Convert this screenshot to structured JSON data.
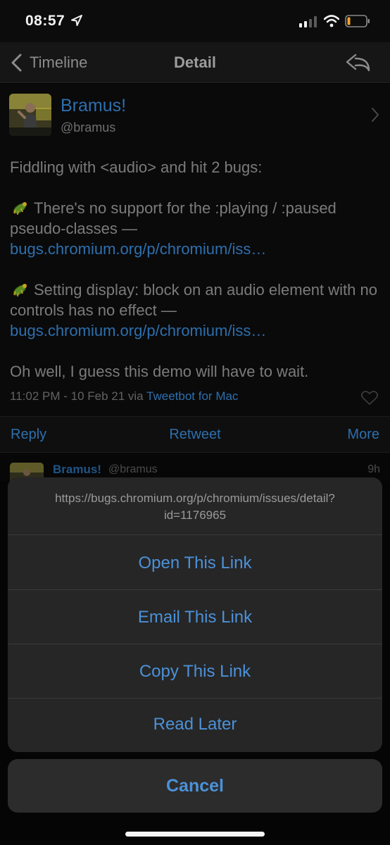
{
  "status_bar": {
    "time": "08:57",
    "icons": [
      "location-arrow-icon",
      "cellular-signal-icon",
      "wifi-icon",
      "battery-low-icon"
    ]
  },
  "nav": {
    "back_label": "Timeline",
    "title": "Detail",
    "icons": [
      "chevron-left-icon",
      "reply-arrow-icon"
    ]
  },
  "tweet": {
    "author_name": "Bramus!",
    "author_handle": "@bramus",
    "intro": "Fiddling with <audio> and hit 2 bugs:",
    "bug1_text": "There's no support for the :playing / :paused pseudo-classes — ",
    "bug1_link": "bugs.chromium.org/p/chromium/iss…",
    "bug2_text": "Setting display: block on an audio element with no controls has no effect — ",
    "bug2_link": "bugs.chromium.org/p/chromium/iss…",
    "outro": "Oh well, I guess this demo will have to wait.",
    "timestamp": "11:02 PM - 10 Feb 21 via ",
    "client": "Tweetbot for Mac",
    "bug_icon": "bug-emoji-icon"
  },
  "actions": {
    "reply": "Reply",
    "retweet": "Retweet",
    "more": "More"
  },
  "reply_preview": {
    "name": "Bramus!",
    "handle": "@bramus",
    "time": "9h"
  },
  "sheet": {
    "url": "https://bugs.chromium.org/p/chromium/issues/detail?id=1176965",
    "options": [
      "Open This Link",
      "Email This Link",
      "Copy This Link",
      "Read Later"
    ],
    "cancel": "Cancel"
  },
  "colors": {
    "link": "#2d6fae",
    "sheet_action": "#4c91d8",
    "sheet_bg": "#262626"
  }
}
